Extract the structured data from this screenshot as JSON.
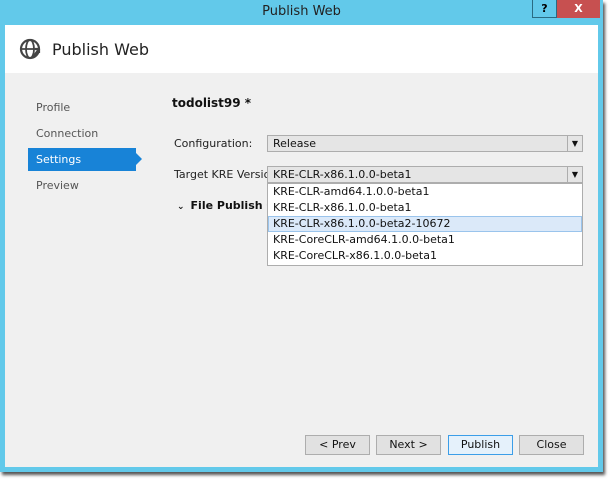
{
  "window": {
    "title": "Publish Web",
    "help": "?",
    "close": "X"
  },
  "header": {
    "title": "Publish Web"
  },
  "sidebar": {
    "items": [
      {
        "label": "Profile"
      },
      {
        "label": "Connection"
      },
      {
        "label": "Settings"
      },
      {
        "label": "Preview"
      }
    ],
    "selected": "Settings"
  },
  "main": {
    "profile_name": "todolist99 *",
    "configuration": {
      "label": "Configuration:",
      "value": "Release"
    },
    "target_kre": {
      "label": "Target KRE Version:",
      "value": "KRE-CLR-x86.1.0.0-beta1",
      "options": [
        "KRE-CLR-amd64.1.0.0-beta1",
        "KRE-CLR-x86.1.0.0-beta1",
        "KRE-CLR-x86.1.0.0-beta2-10672",
        "KRE-CoreCLR-amd64.1.0.0-beta1",
        "KRE-CoreCLR-x86.1.0.0-beta1"
      ],
      "highlighted": "KRE-CLR-x86.1.0.0-beta2-10672"
    },
    "file_publish_options": "File Publish Options"
  },
  "buttons": {
    "prev": "< Prev",
    "next": "Next >",
    "publish": "Publish",
    "close": "Close"
  }
}
